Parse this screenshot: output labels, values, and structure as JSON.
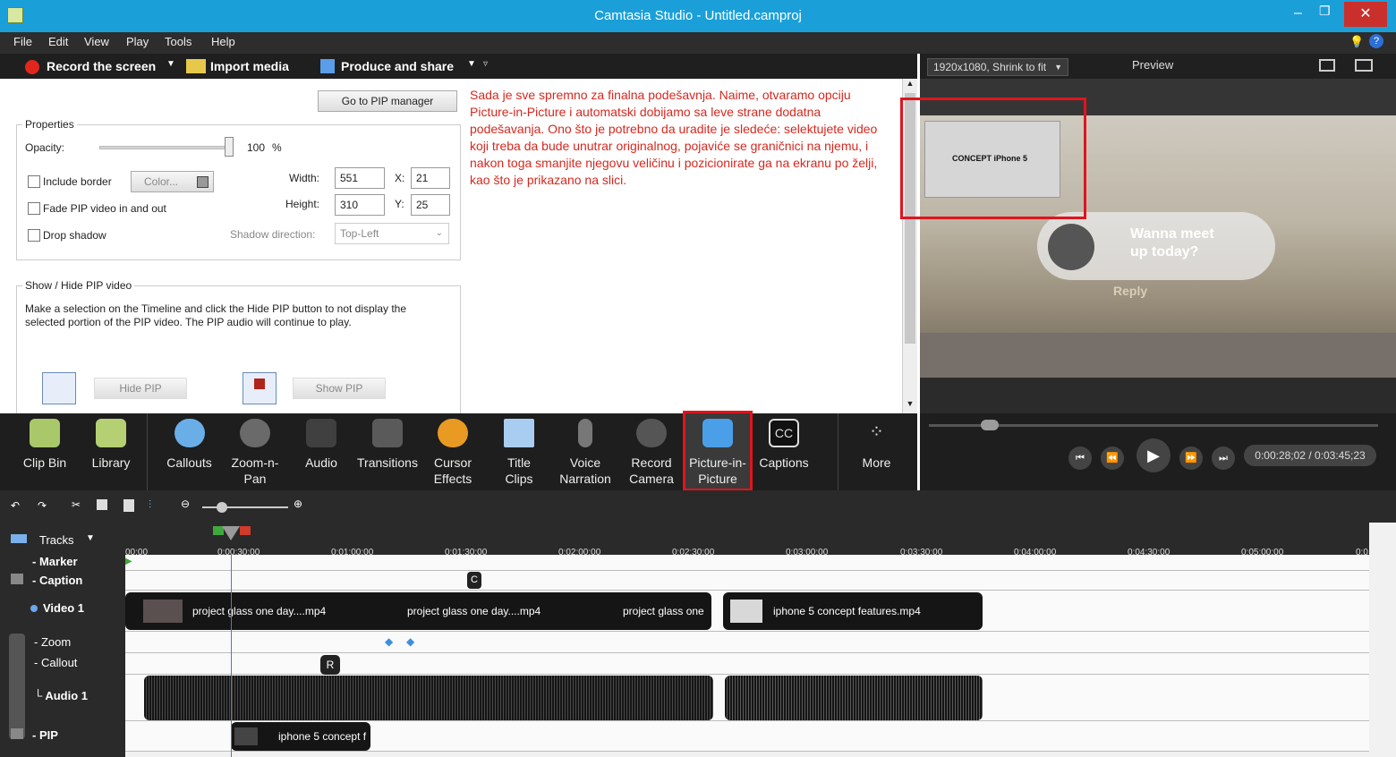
{
  "window": {
    "title": "Camtasia Studio - Untitled.camproj"
  },
  "menu": [
    "File",
    "Edit",
    "View",
    "Play",
    "Tools",
    "Help"
  ],
  "toolbar": {
    "record": "Record the screen",
    "import": "Import media",
    "produce": "Produce and share"
  },
  "pip_panel": {
    "go_button": "Go to PIP manager",
    "properties_label": "Properties",
    "opacity_label": "Opacity:",
    "opacity_value": "100",
    "opacity_unit": "%",
    "include_border": "Include border",
    "color_button": "Color...",
    "width_label": "Width:",
    "width_value": "551",
    "x_label": "X:",
    "x_value": "21",
    "height_label": "Height:",
    "height_value": "310",
    "y_label": "Y:",
    "y_value": "25",
    "fade": "Fade PIP video in and out",
    "drop_shadow": "Drop shadow",
    "shadow_label": "Shadow direction:",
    "shadow_value": "Top-Left",
    "showhide_label": "Show / Hide PIP video",
    "showhide_text": "Make a selection on the Timeline and click the Hide PIP button to not display the selected portion of the PIP video. The PIP audio will continue to play.",
    "hide_button": "Hide PIP",
    "show_button": "Show PIP"
  },
  "note": "Sada je sve spremno za finalna podešavnja. Naime, otvaramo opciju Picture-in-Picture i automatski dobijamo sa leve strane dodatna podešavanja. Ono što je potrebno da uradite je sledeće: selektujete video koji treba da bude unutrar originalnog, pojaviće se graničnici na njemu, i nakon toga smanjite njegovu veličinu i pozicionirate ga na ekranu po želji, kao što je prikazano na slici.",
  "preview": {
    "resolution": "1920x1080, Shrink to fit",
    "label": "Preview",
    "pip_text": "CONCEPT iPhone 5",
    "bubble_text1": "Wanna meet",
    "bubble_text2": "up today?",
    "reply": "Reply",
    "time": "0:00:28;02 / 0:03:45;23"
  },
  "tools": [
    {
      "label1": "Clip Bin",
      "label2": ""
    },
    {
      "label1": "Library",
      "label2": ""
    },
    {
      "label1": "Callouts",
      "label2": ""
    },
    {
      "label1": "Zoom-n-",
      "label2": "Pan"
    },
    {
      "label1": "Audio",
      "label2": ""
    },
    {
      "label1": "Transitions",
      "label2": ""
    },
    {
      "label1": "Cursor",
      "label2": "Effects"
    },
    {
      "label1": "Title",
      "label2": "Clips"
    },
    {
      "label1": "Voice",
      "label2": "Narration"
    },
    {
      "label1": "Record",
      "label2": "Camera"
    },
    {
      "label1": "Picture-in-",
      "label2": "Picture"
    },
    {
      "label1": "Captions",
      "label2": ""
    },
    {
      "label1": "More",
      "label2": ""
    }
  ],
  "timeline": {
    "tracks_label": "Tracks",
    "ruler": [
      "00;00",
      "0:00:30;00",
      "0:01:00;00",
      "0:01:30;00",
      "0:02:00;00",
      "0:02:30;00",
      "0:03:00;00",
      "0:03:30;00",
      "0:04:00;00",
      "0:04:30;00",
      "0:05:00;00",
      "0:0"
    ],
    "rows": {
      "marker": "Marker",
      "caption": "Caption",
      "video": "Video 1",
      "zoom": "Zoom",
      "callout": "Callout",
      "audio": "Audio 1",
      "pip": "PIP"
    },
    "clips": {
      "v1": "project glass one day....mp4",
      "v2": "project glass one day....mp4",
      "v3": "project glass one",
      "v4": "iphone 5 concept features.mp4",
      "pip": "iphone 5 concept f",
      "caption_marker": "C",
      "callout_marker": "R"
    }
  }
}
